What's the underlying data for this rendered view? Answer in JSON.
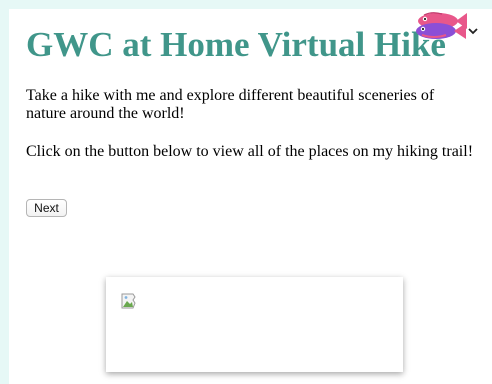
{
  "header": {
    "title": "GWC at Home Virtual Hike"
  },
  "content": {
    "intro": "Take a hike with me and explore different beautiful sceneries of nature around the world!",
    "instruction": "Click on the button below to view all of the places on my hiking trail!"
  },
  "controls": {
    "next_label": "Next"
  },
  "colors": {
    "title": "#40968a",
    "background": "#e6f8f6",
    "fish_pink": "#e8578a",
    "fish_purple": "#8b4fd6"
  },
  "icons": {
    "fish": "fish-icon",
    "chevron": "chevron-down-icon",
    "broken_image": "broken-image-icon"
  }
}
